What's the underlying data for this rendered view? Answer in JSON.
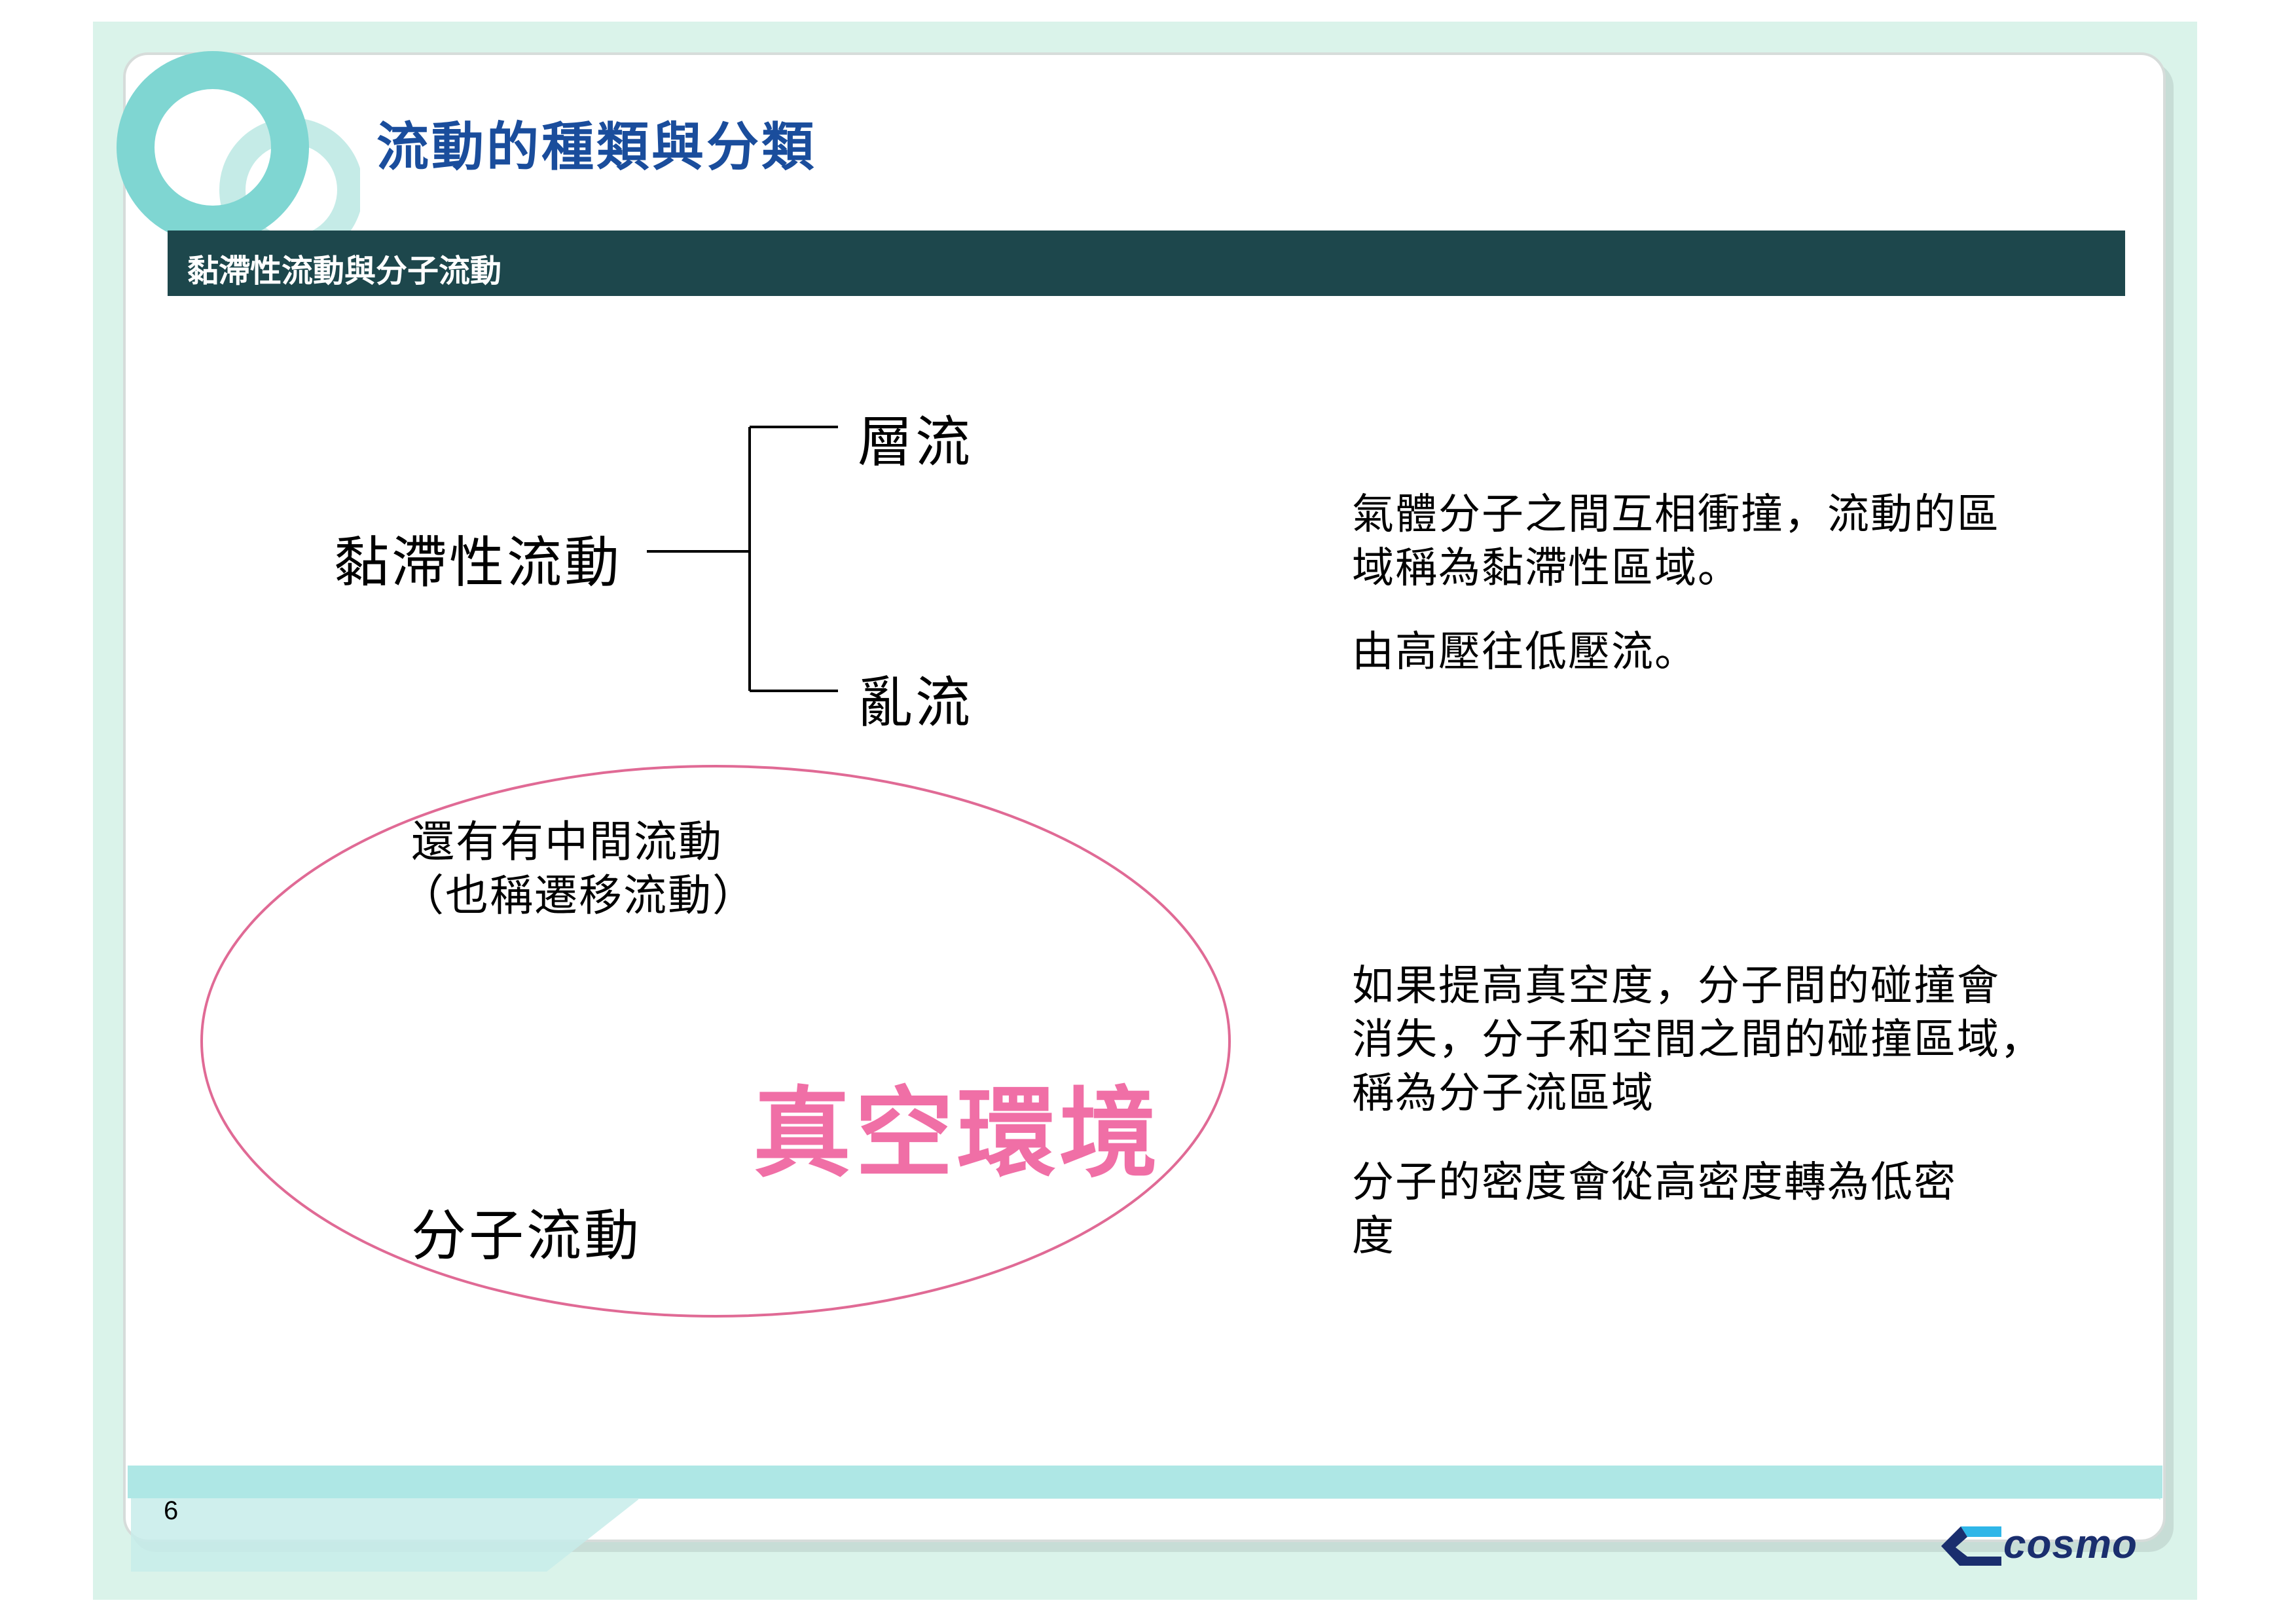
{
  "slide": {
    "title": "流動的種類與分類",
    "section": "黏滯性流動與分子流動",
    "page_number": "6"
  },
  "tree": {
    "root": "黏滯性流動",
    "branch_top": "層流",
    "branch_bottom": "亂流"
  },
  "viscous_desc": {
    "line1": "氣體分子之間互相衝撞，流動的區",
    "line2": "域稱為黏滯性區域。",
    "line3": "由高壓往低壓流。"
  },
  "ellipse": {
    "intermediate_line1": "還有有中間流動",
    "intermediate_line2": "（也稱遷移流動）",
    "vacuum": "真空環境",
    "molecular": "分子流動"
  },
  "molecular_desc": {
    "line1": "如果提高真空度，分子間的碰撞會",
    "line2": "消失，分子和空間之間的碰撞區域，",
    "line3": "稱為分子流區域",
    "line4": "分子的密度會從高密度轉為低密",
    "line5": "度"
  },
  "logo": {
    "text": "cosmo",
    "icon": "cosmo-logo-mark"
  },
  "colors": {
    "title": "#1a4d9c",
    "section_bar": "#1d474c",
    "vacuum_text": "#f06fa6",
    "ellipse_stroke": "#e06a95",
    "background": "#daf3ea",
    "footer_band": "#aee7e5",
    "logo_blue": "#1a2e6e"
  }
}
